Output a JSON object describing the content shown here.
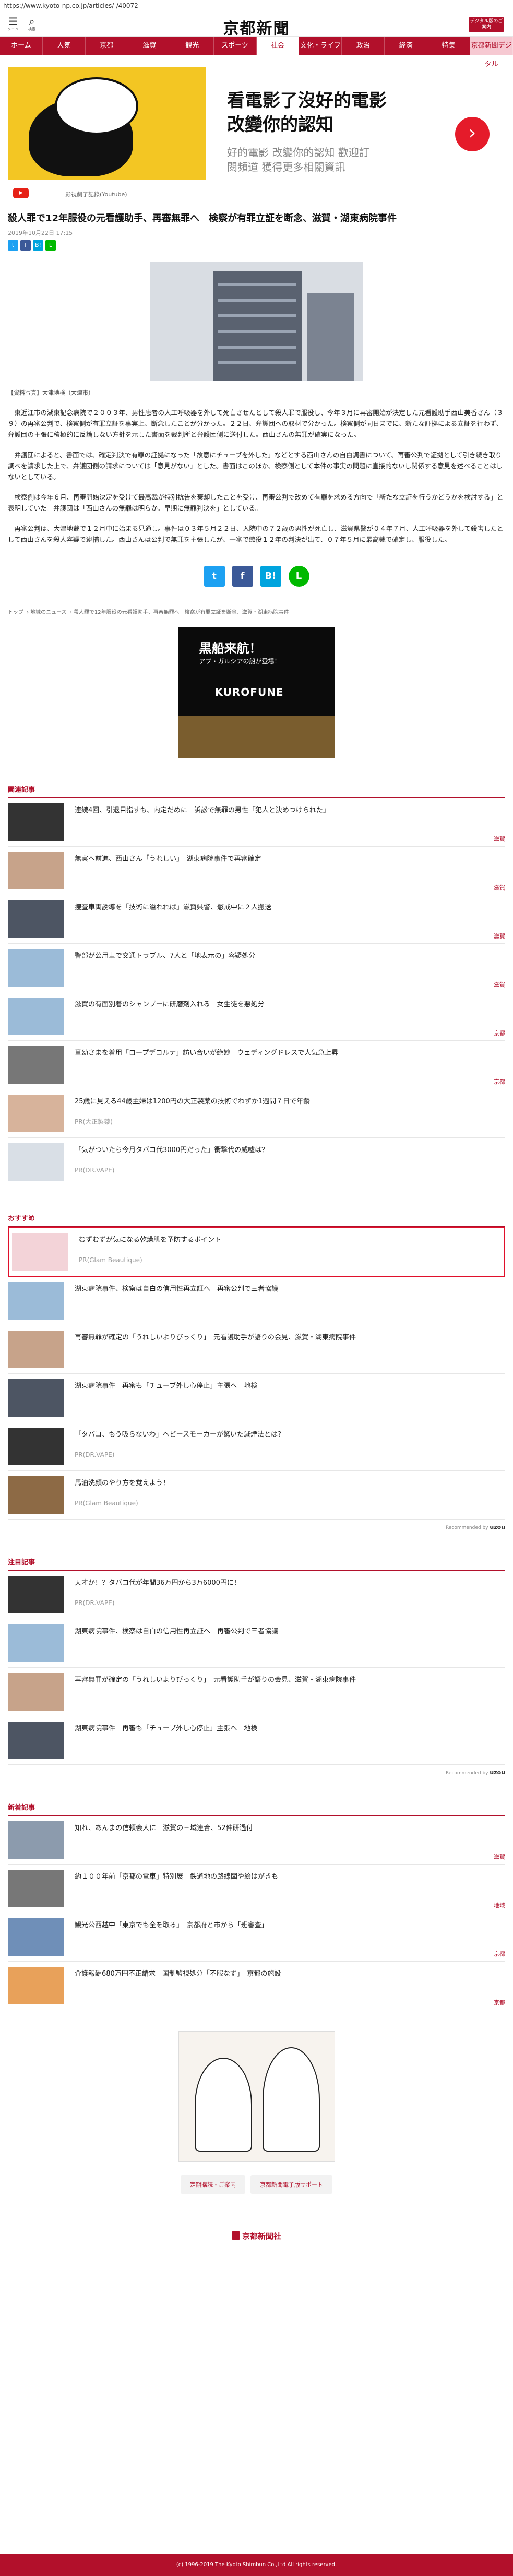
{
  "url": "https://www.kyoto-np.co.jp/articles/-/40072",
  "header": {
    "menu_label": "メニュー",
    "search_label": "検索",
    "logo": "京都新聞",
    "digital_label": "デジタル版のご案内"
  },
  "nav": [
    "ホーム",
    "人気",
    "京都",
    "滋賀",
    "観光",
    "スポーツ",
    "社会",
    "文化・ライフ",
    "政治",
    "経済",
    "特集",
    "京都新聞デジタル"
  ],
  "ad_top": {
    "title_line1": "看電影了沒好的電影",
    "title_line2": "改變你的認知",
    "sub_line1": "好的電影 改變你的認知 歡迎訂",
    "sub_line2": "閱頻道 獲得更多相關資訊",
    "source": "影視劇了記錄(Youtube)"
  },
  "article": {
    "title": "殺人罪で12年服役の元看護助手、再審無罪へ　検察が有罪立証を断念、滋賀・湖東病院事件",
    "date": "2019年10月22日 17:15",
    "caption": "【資料写真】大津地検（大津市）",
    "paragraphs": [
      "東近江市の湖東記念病院で２００３年、男性患者の人工呼吸器を外して死亡させたとして殺人罪で服役し、今年３月に再審開始が決定した元看護助手西山美香さん（３９）の再審公判で、検察側が有罪立証を事実上、断念したことが分かった。２２日、弁護団への取材で分かった。検察側が同日までに、新たな証拠による立証を行わず、弁護団の主張に積極的に反論しない方針を示した書面を裁判所と弁護団側に送付した。西山さんの無罪が確実になった。",
      "弁護団によると、書面では、確定判決で有罪の証拠になった「故意にチューブを外した」などとする西山さんの自白調書について、再審公判で証拠として引き続き取り調べを請求した上で、弁護団側の請求については「意見がない」とした。書面はこのほか、検察側として本件の事実の問題に直接的ないし関係する意見を述べることはしないとしている。",
      "検察側は今年６月、再審開始決定を受けて最高裁が特別抗告を棄却したことを受け、再審公判で改めて有罪を求める方向で「新たな立証を行うかどうかを検討する」と表明していた。弁護団は「西山さんの無罪は明らか。早期に無罪判決を」としている。",
      "再審公判は、大津地裁で１２月中に始まる見通し。事件は０３年５月２２日、入院中の７２歳の男性が死亡し、滋賀県警が０４年７月、人工呼吸器を外して殺害したとして西山さんを殺人容疑で逮捕した。西山さんは公判で無罪を主張したが、一審で懲役１２年の判決が出て、０７年５月に最高裁で確定し、服役した。"
    ]
  },
  "breadcrumb": [
    "トップ",
    "地域のニュース",
    "殺人罪で12年服役の元看護助手、再審無罪へ　検察が有罪立証を断念、滋賀・湖東病院事件"
  ],
  "ad_mid": {
    "line1": "黒船来航！",
    "line2": "アブ・ガルシアの船が登場！",
    "brand": "KUROFUNE"
  },
  "related": {
    "title": "関連記事",
    "items": [
      {
        "text": "連続4回、引退目指すも、内定だめに　訴訟で無罪の男性「犯人と決めつけられた」",
        "cat": "滋賀"
      },
      {
        "text": "無実へ前進、西山さん「うれしい」　湖東病院事件で再審確定",
        "cat": "滋賀"
      },
      {
        "text": "捜査車両誘導を「技術に溢れれば」滋賀県警、懲戒中に２人搬送",
        "cat": "滋賀"
      },
      {
        "text": "警部が公用車で交通トラブル、7人と「地表示の」容疑処分",
        "cat": "滋賀"
      },
      {
        "text": "滋賀の有面別着のシャンプーに研磨剤入れる　女生徒を悪処分",
        "cat": "京都"
      },
      {
        "text": "童幼さまを着用「ロープデコルテ」訪い合いが絶妙　ウェディングドレスで人気急上昇",
        "cat": "京都"
      },
      {
        "text": "25歳に見える44歳主婦は1200円の大正製薬の技術でわずか1週間７日で年齢",
        "pr": "PR(大正製薬)"
      },
      {
        "text": "「気がついたら今月タバコ代3000円だった」衝撃代の威嘘は？",
        "pr": "PR(DR.VAPE)"
      }
    ]
  },
  "recommended": {
    "title": "おすすめ",
    "items": [
      {
        "text": "むずむずが気になる乾燥肌を予防するポイント",
        "pr": "PR(Glam Beautique)"
      },
      {
        "text": "湖東病院事件、検察は自白の信用性再立証へ　再審公判で三者協議"
      },
      {
        "text": "再審無罪が確定の「うれしいよりびっくり」　元看護助手が語りの会見、滋賀・湖東病院事件"
      },
      {
        "text": "湖東病院事件　再審も「チューブ外し心停止」主張へ　地検"
      },
      {
        "text": "「タバコ、もう吸らないわ」ヘビースモーカーが驚いた減煙法とは？",
        "pr": "PR(DR.VAPE)"
      },
      {
        "text": "馬油洗顔のやり方を覚えよう！",
        "pr": "PR(Glam Beautique)"
      }
    ],
    "powered": "Recommended by"
  },
  "popular": {
    "title": "注目記事",
    "items": [
      {
        "text": "天才か！？タバコ代が年間36万円から3万6000円に！",
        "pr": "PR(DR.VAPE)"
      },
      {
        "text": "湖東病院事件、検察は自白の信用性再立証へ　再審公判で三者協議"
      },
      {
        "text": "再審無罪が確定の「うれしいよりびっくり」　元看護助手が語りの会見、滋賀・湖東病院事件"
      },
      {
        "text": "湖東病院事件　再審も「チューブ外し心停止」主張へ　地検"
      }
    ],
    "powered": "Recommended by"
  },
  "latest": {
    "title": "新着記事",
    "items": [
      {
        "text": "知れ、あんまの信頼会人に　滋賀の三域連合、52件研過付",
        "cat": "滋賀"
      },
      {
        "text": "約１００年前「京都の電車」特別展　鉄道地の路線図や絵はがきも",
        "cat": "地域"
      },
      {
        "text": "観光公西越中「東京でも全を取る」　京都府と市から「班審査」",
        "cat": "京都"
      },
      {
        "text": "介護報酬680万円不正請求　国制監視処分「不服なず」　京都の施設",
        "cat": "京都"
      }
    ]
  },
  "footer": {
    "links": [
      "定期購読・ご案内",
      "京都新聞電子版サポート"
    ],
    "logo": "京都新聞社",
    "copyright": "(c) 1996-2019 The Kyoto Shimbun Co.,Ltd All rights reserved."
  }
}
